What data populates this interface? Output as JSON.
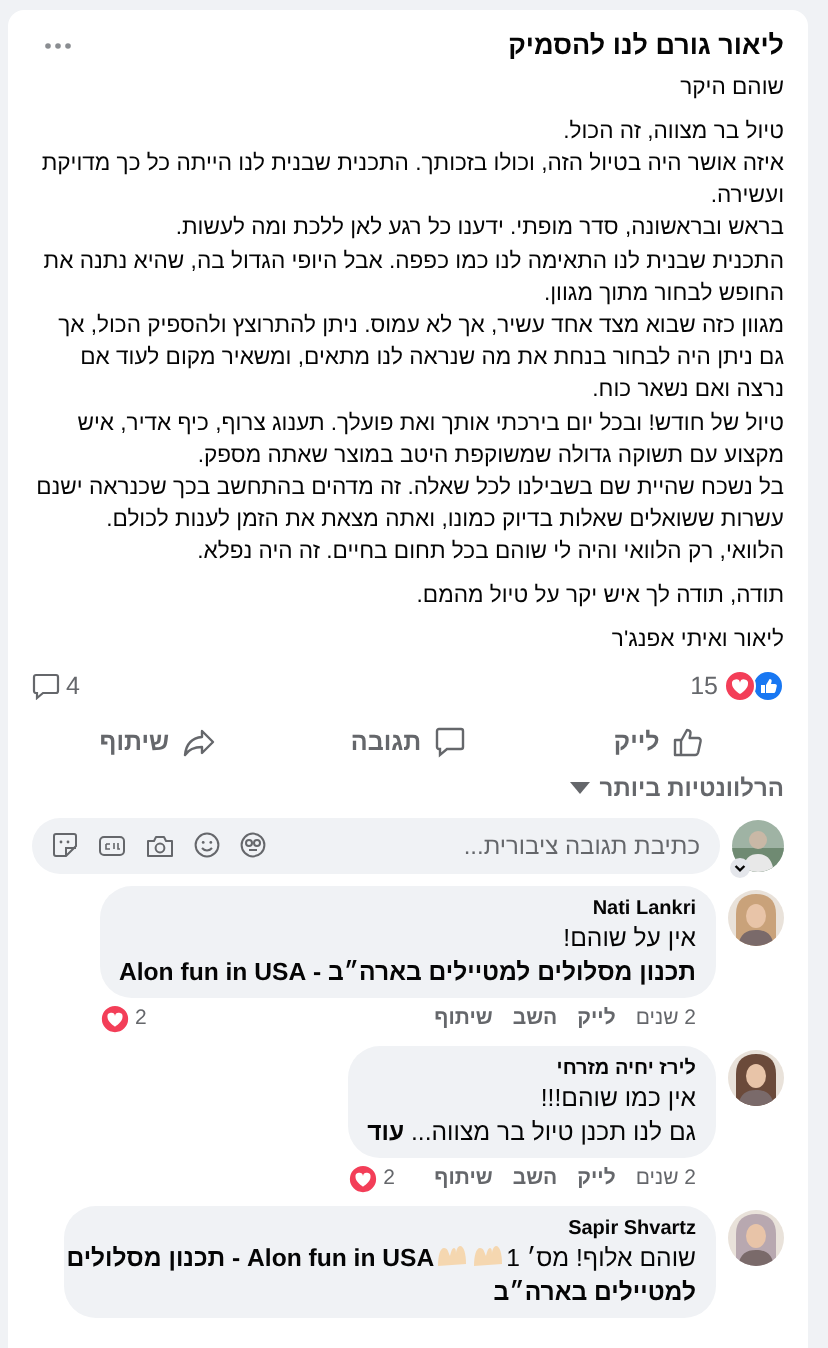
{
  "post": {
    "title": "ליאור גורם לנו להסמיק",
    "paragraphs": [
      [
        "שוהם היקר"
      ],
      [
        "טיול בר מצווה, זה הכול.",
        "איזה אושר היה בטיול הזה, וכולו בזכותך. התכנית שבנית לנו הייתה כל כך מדויקת ועשירה.",
        "בראש ובראשונה, סדר מופתי. ידענו כל רגע לאן ללכת ומה לעשות.",
        "התכנית שבנית לנו התאימה לנו כמו כפפה. אבל היופי הגדול בה, שהיא נתנה את החופש לבחור מתוך מגוון.",
        "מגוון כזה שבוא מצד אחד עשיר, אך לא עמוס. ניתן להתרוצץ ולהספיק הכול, אך גם ניתן היה לבחור בנחת את מה שנראה לנו מתאים, ומשאיר מקום לעוד אם נרצה ואם נשאר כוח.",
        "טיול של חודש! ובכל יום בירכתי אותך ואת פועלך. תענוג צרוף, כיף אדיר, איש מקצוע עם תשוקה גדולה שמשוקפת היטב במוצר שאתה מספק.",
        "בל נשכח שהיית שם בשבילנו לכל שאלה. זה מדהים בהתחשב בכך שכנראה ישנם עשרות ששואלים שאלות בדיוק כמונו, ואתה מצאת את הזמן לענות לכולם.",
        "הלוואי, רק הלוואי והיה לי שוהם בכל תחום בחיים. זה היה נפלא."
      ],
      [
        "תודה, תודה לך איש יקר על טיול מהמם."
      ],
      [
        "ליאור ואיתי אפנג'ר"
      ]
    ],
    "reactions": "15",
    "comments_count": "4"
  },
  "actions": [
    {
      "kind": "like",
      "label": "לייק"
    },
    {
      "kind": "comment",
      "label": "תגובה"
    },
    {
      "kind": "share",
      "label": "שיתוף"
    }
  ],
  "sort": {
    "label": "הרלוונטיות ביותר"
  },
  "comment_box": {
    "placeholder": "כתיבת תגובה ציבורית..."
  },
  "comments": [
    {
      "author": "Nati Lankri",
      "lines": [
        [
          {
            "kind": "text",
            "text": "אין על שוהם!"
          }
        ],
        [
          {
            "kind": "tag",
            "text": "תכנון מסלולים למטיילים בארה״ב - Alon fun in USA"
          }
        ]
      ],
      "time": "2 שנים",
      "links": [
        "לייק",
        "השב",
        "שיתוף"
      ],
      "reactions": "2"
    },
    {
      "author": "לירז יחיה מזרחי",
      "lines": [
        [
          {
            "kind": "text",
            "text": "אין כמו שוהם!!!"
          }
        ],
        [
          {
            "kind": "text",
            "text": "גם לנו תכנן טיול בר מצווה... **עוד**"
          }
        ]
      ],
      "time": "2 שנים",
      "links": [
        "לייק",
        "השב",
        "שיתוף"
      ],
      "reactions": "2"
    },
    {
      "author": "Sapir Shvartz",
      "lines": [
        [
          {
            "kind": "text",
            "text": "שוהם אלוף! מס׳ 1"
          },
          {
            "kind": "emoji"
          },
          {
            "kind": "emoji"
          },
          {
            "kind": "tag",
            "text": "Alon fun in USA - תכנון מסלולים"
          }
        ],
        [
          {
            "kind": "tag",
            "text": "למטיילים בארה״ב"
          }
        ]
      ]
    }
  ]
}
